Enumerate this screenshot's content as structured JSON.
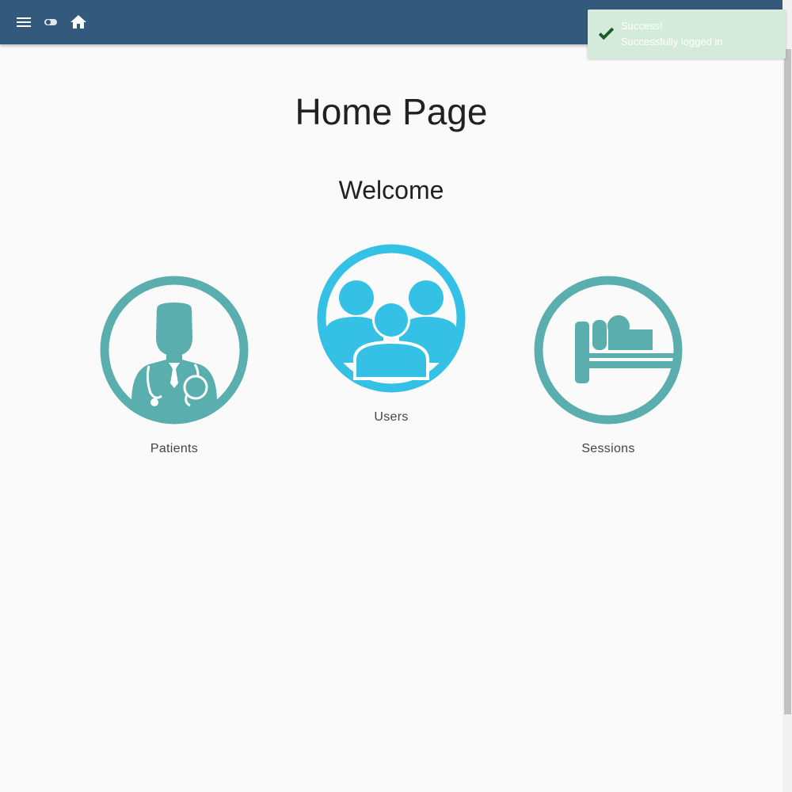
{
  "toolbar": {
    "icons": [
      "menu-icon",
      "theme-toggle-icon",
      "home-icon"
    ]
  },
  "main": {
    "title": "Home Page",
    "subtitle": "Welcome",
    "tiles": [
      {
        "label": "Patients",
        "icon": "doctor-icon"
      },
      {
        "label": "Users",
        "icon": "users-group-icon"
      },
      {
        "label": "Sessions",
        "icon": "bed-patient-icon"
      }
    ]
  },
  "toast": {
    "title": "Success!",
    "message": "Successfully logged in",
    "icon": "check-icon"
  },
  "colors": {
    "toolbar": "#335a7c",
    "teal": "#5aaeae",
    "sky": "#35c0e6",
    "toast_bg": "#d4ebdb",
    "check": "#1e5a28"
  }
}
